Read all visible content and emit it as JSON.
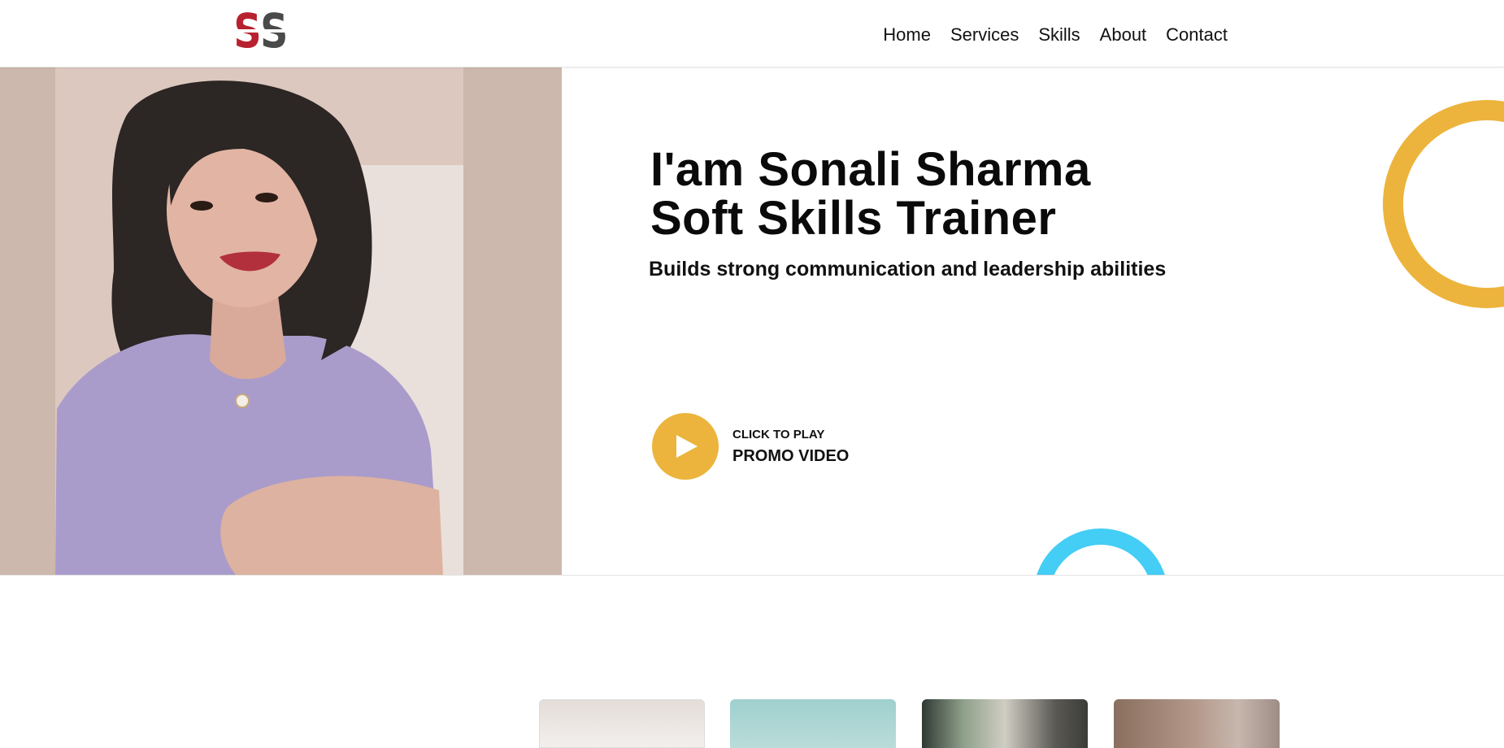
{
  "header": {
    "logo_text": "SS",
    "nav": [
      "Home",
      "Services",
      "Skills",
      "About",
      "Contact"
    ]
  },
  "hero": {
    "title_line1": "I'am Sonali Sharma",
    "title_line2": "Soft Skills Trainer",
    "subtitle": "Builds strong communication and leadership abilities",
    "play_small": "CLICK TO PLAY",
    "play_big": "PROMO VIDEO"
  },
  "colors": {
    "accent_yellow": "#ecb43c",
    "accent_blue": "#44cdf5",
    "logo_red": "#b8212f",
    "logo_gray": "#4a4a4a"
  },
  "icons": [
    "play-icon"
  ]
}
